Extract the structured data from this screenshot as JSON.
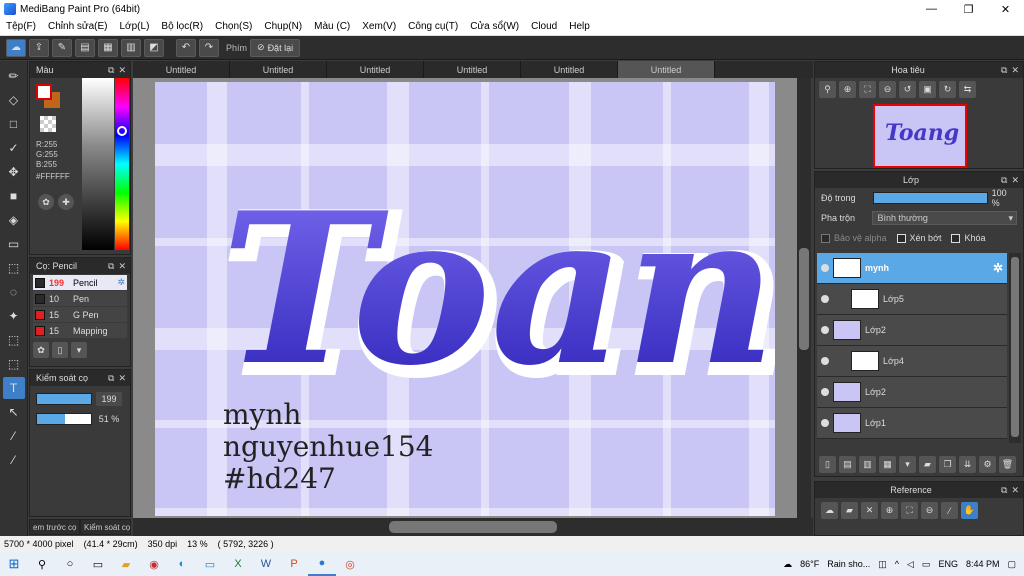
{
  "window": {
    "title": "MediBang Paint Pro (64bit)",
    "minimize": "—",
    "maximize": "❐",
    "close": "✕"
  },
  "menu": [
    "Tệp(F)",
    "Chỉnh sửa(E)",
    "Lớp(L)",
    "Bộ lọc(R)",
    "Chọn(S)",
    "Chụp(N)",
    "Màu (C)",
    "Xem(V)",
    "Công cụ(T)",
    "Cửa sổ(W)",
    "Cloud",
    "Help"
  ],
  "toolbar": {
    "shortcut_label": "Phím",
    "reset_label": "Đặt lại"
  },
  "color_panel": {
    "title": "Màu",
    "r": "R:255",
    "g": "G:255",
    "b": "B:255",
    "hex": "#FFFFFF",
    "fg_color": "#ffffff",
    "bg_color": "#c0661a"
  },
  "brush_panel": {
    "title": "Cọ: Pencil",
    "brushes": [
      {
        "size": "199",
        "name": "Pencil",
        "color": "#2a2a2a",
        "selected": true
      },
      {
        "size": "10",
        "name": "Pen",
        "color": "#2a2a2a",
        "selected": false
      },
      {
        "size": "15",
        "name": "G Pen",
        "color": "#e02020",
        "selected": false
      },
      {
        "size": "15",
        "name": "Mapping",
        "color": "#e02020",
        "selected": false
      }
    ]
  },
  "brush_control": {
    "title": "Kiểm soát cọ",
    "size_value": "199",
    "size_fraction": 1.0,
    "opacity_value": "51 %",
    "opacity_fraction": 0.51
  },
  "bottom_tabs": [
    "em trước cọ",
    "Kiểm soát cọ"
  ],
  "doc_tabs": [
    {
      "label": "Untitled",
      "active": false
    },
    {
      "label": "Untitled",
      "active": false
    },
    {
      "label": "Untitled",
      "active": false
    },
    {
      "label": "Untitled",
      "active": false
    },
    {
      "label": "Untitled",
      "active": false
    },
    {
      "label": "Untitled",
      "active": true
    }
  ],
  "canvas": {
    "main_text": "Toang",
    "line1": "mynh",
    "line2": "nguyenhue154",
    "line3": "#hd247",
    "background_color": "#c9c5f5",
    "lettering_color": "#4538c9"
  },
  "status": {
    "size": "5700 * 4000 pixel",
    "cm": "(41.4 * 29cm)",
    "dpi": "350 dpi",
    "zoom": "13 %",
    "coords": "( 5792, 3226 )"
  },
  "navigator": {
    "title": "Hoa tiêu",
    "thumb_text": "Toang"
  },
  "layer_panel": {
    "title": "Lớp",
    "opacity_label": "Độ trong",
    "opacity_value": "100 %",
    "blend_label": "Pha trộn",
    "blend_value": "Bình thường",
    "protect_alpha": "Bảo vệ alpha",
    "clipping": "Xén bớt",
    "lock": "Khóa",
    "layers": [
      {
        "name": "mynh",
        "selected": true,
        "indent": false,
        "thumb": "white"
      },
      {
        "name": "Lớp5",
        "selected": false,
        "indent": true,
        "thumb": "white"
      },
      {
        "name": "Lớp2",
        "selected": false,
        "indent": false,
        "thumb": "purple"
      },
      {
        "name": "Lớp4",
        "selected": false,
        "indent": true,
        "thumb": "white"
      },
      {
        "name": "Lớp2",
        "selected": false,
        "indent": false,
        "thumb": "purple"
      },
      {
        "name": "Lớp1",
        "selected": false,
        "indent": false,
        "thumb": "purple"
      }
    ]
  },
  "reference_panel": {
    "title": "Reference"
  },
  "taskbar": {
    "weather_temp": "86°F",
    "weather_text": "Rain sho...",
    "lang": "ENG",
    "time": "8:44 PM"
  }
}
